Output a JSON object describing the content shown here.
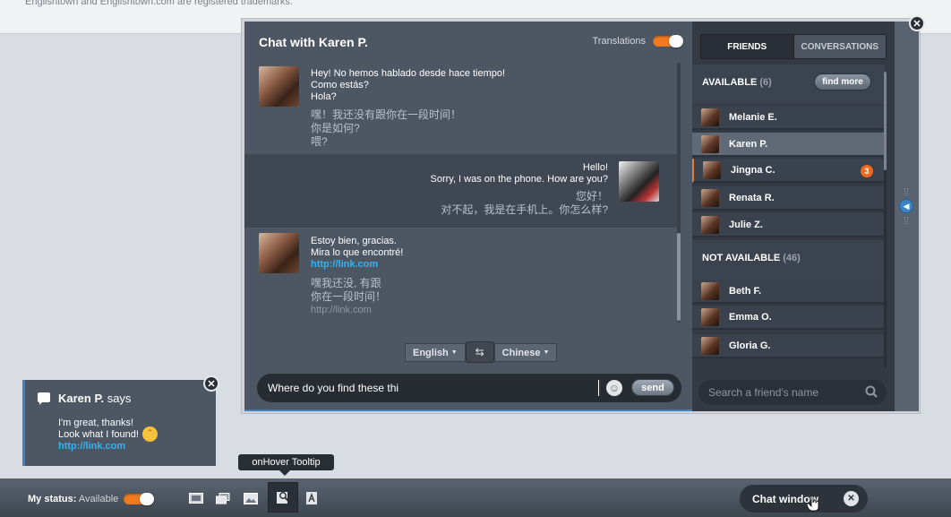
{
  "page": {
    "trademark": "Englishtown and Englishtown.com are registered trademarks."
  },
  "chat": {
    "title": "Chat with Karen P.",
    "translations_label": "Translations",
    "messages": [
      {
        "from": "Karen P.",
        "text": [
          "Hey! No hemos hablado desde hace tiempo!",
          "Como estás?",
          "Hola?"
        ],
        "translation": [
          "嘿！我还没有跟你在一段时间！",
          "你是如何?",
          "喂?"
        ]
      },
      {
        "from": "me",
        "text": [
          "Hello!",
          "Sorry, I was on the phone. How are you?"
        ],
        "translation": [
          "您好！",
          "对不起，我是在手机上。你怎么样?"
        ]
      },
      {
        "from": "Karen P.",
        "text": [
          "Estoy bien, gracias.",
          "Mira lo que encontré!"
        ],
        "link": "http://link.com",
        "translation": [
          "嘿我还没, 有跟",
          "你在一段时间！"
        ],
        "link_translation": "http://link.com"
      }
    ],
    "source_language": "English",
    "target_language": "Chinese",
    "swap_icon": "swap-arrows-icon",
    "input_value": "Where do you find these thi",
    "emoji_icon": "smiley-icon",
    "send_label": "send"
  },
  "friends": {
    "tabs": [
      "FRIENDS",
      "CONVERSATIONS"
    ],
    "active_tab": "FRIENDS",
    "available_label": "AVAILABLE",
    "available_count": "(6)",
    "find_more_label": "find more",
    "available": [
      {
        "name": "Melanie E."
      },
      {
        "name": "Karen P.",
        "selected": true
      },
      {
        "name": "Jingna C.",
        "unread": "3"
      },
      {
        "name": "Renata R."
      },
      {
        "name": "Julie Z."
      }
    ],
    "not_available_label": "NOT AVAILABLE",
    "not_available_count": "(46)",
    "not_available": [
      {
        "name": "Beth F."
      },
      {
        "name": "Emma O."
      },
      {
        "name": "Gloria G."
      }
    ],
    "search_placeholder": "Search a friend's name"
  },
  "toast": {
    "name": "Karen P.",
    "says": "says",
    "line1": "I'm great, thanks!",
    "line2": "Look what I found!",
    "link": "http://link.com"
  },
  "tooltip": "onHover Tooltip",
  "bottom_bar": {
    "status_label": "My status:",
    "status_value": "Available",
    "tools": [
      "photo-icon",
      "cards-icon",
      "image-edit-icon",
      "profile-search-icon",
      "translate-icon"
    ],
    "chat_window_label": "Chat window"
  },
  "colors": {
    "accent": "#f47a1f",
    "link": "#37b3f2",
    "panel": "#4d5663",
    "highlight": "#3a84c6"
  }
}
